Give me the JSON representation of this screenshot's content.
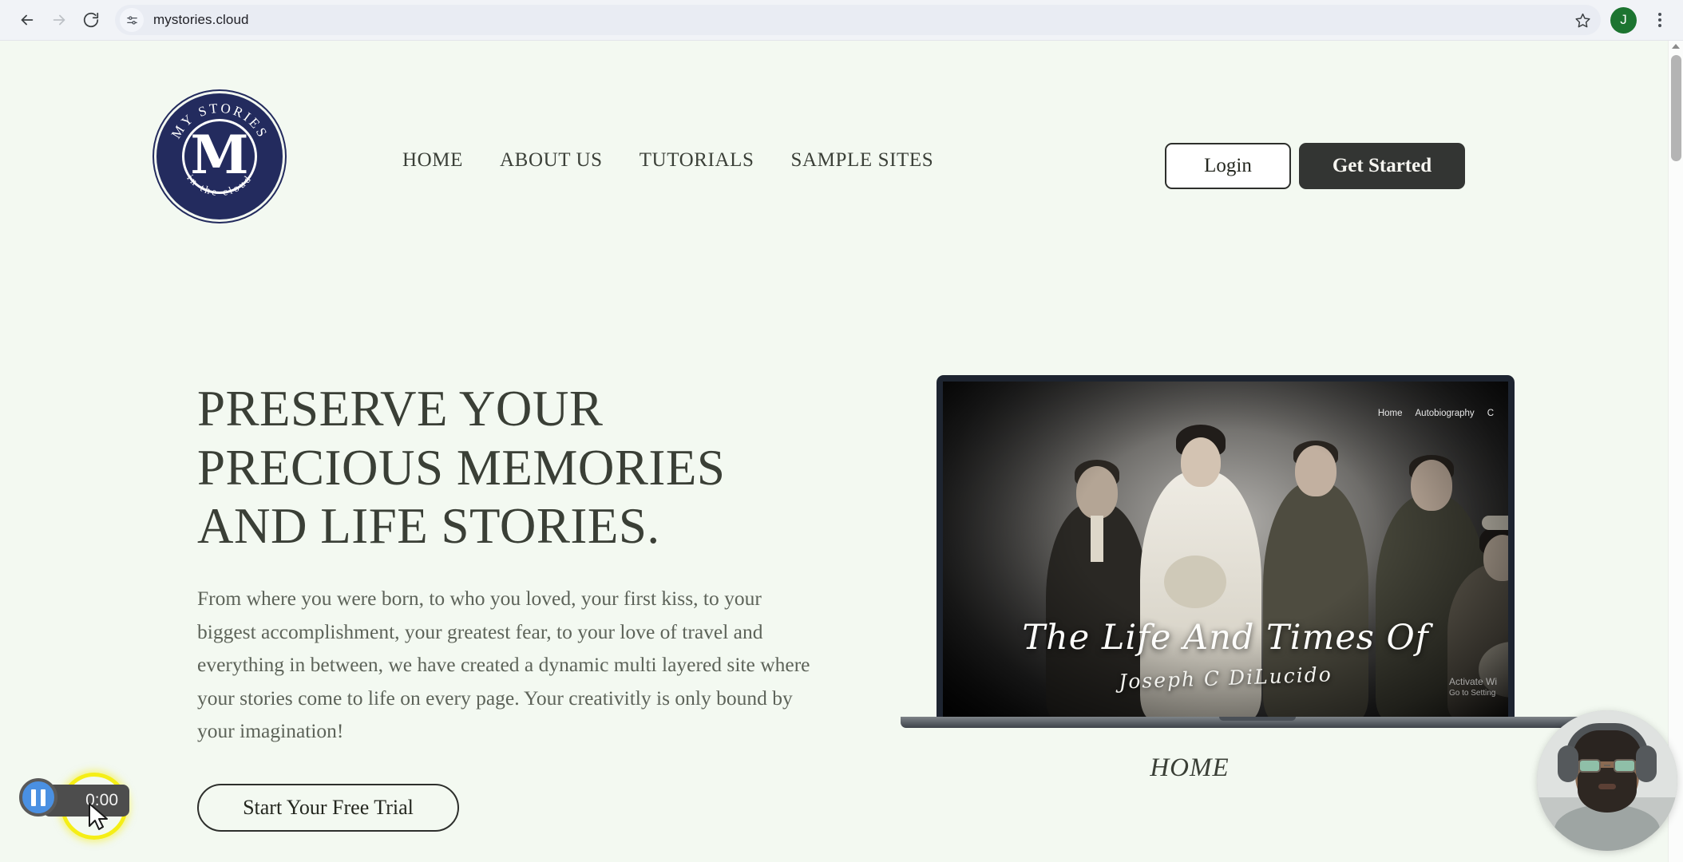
{
  "browser": {
    "url": "mystories.cloud",
    "back_icon": "back-arrow-icon",
    "forward_icon": "forward-arrow-icon",
    "reload_icon": "reload-icon",
    "site_info_icon": "page-settings-icon",
    "bookmark_icon": "star-icon",
    "profile_initial": "J",
    "menu_icon": "kebab-menu-icon"
  },
  "site": {
    "logo": {
      "top_text": "MY STORIES",
      "center_letter": "M",
      "bottom_text": "in the cloud",
      "color": "#232b5e"
    },
    "nav": [
      {
        "label": "HOME"
      },
      {
        "label": "ABOUT US"
      },
      {
        "label": "TUTORIALS"
      },
      {
        "label": "SAMPLE SITES"
      }
    ],
    "actions": {
      "login_label": "Login",
      "get_started_label": "Get Started",
      "get_started_bg": "#333533"
    },
    "hero": {
      "title_line1": "PRESERVE YOUR",
      "title_line2": "PRECIOUS MEMORIES",
      "title_line3": "AND LIFE STORIES.",
      "paragraph": "From where you were born, to who you loved, your first kiss, to your biggest accomplishment, your greatest fear, to your love of travel and everything in between, we have created a dynamic multi layered site where your stories come to life on every page. Your creativitly is only bound by your imagination!",
      "cta_label": "Start Your Free Trial",
      "title_color": "#3a3f36",
      "background": "#f3f9f1"
    },
    "mockup": {
      "caption": "HOME",
      "screen_nav": [
        "Home",
        "Autobiography",
        "C"
      ],
      "screen_title": "The Life And Times Of",
      "screen_signature": "Joseph C DiLucido",
      "watermark_line1": "Activate Wi",
      "watermark_line2": "Go to Setting"
    }
  },
  "recorder": {
    "timer": "0:00",
    "pause_icon": "pause-icon",
    "highlight_color": "#f5ee16"
  },
  "webcam": {
    "label": "presenter-webcam"
  }
}
